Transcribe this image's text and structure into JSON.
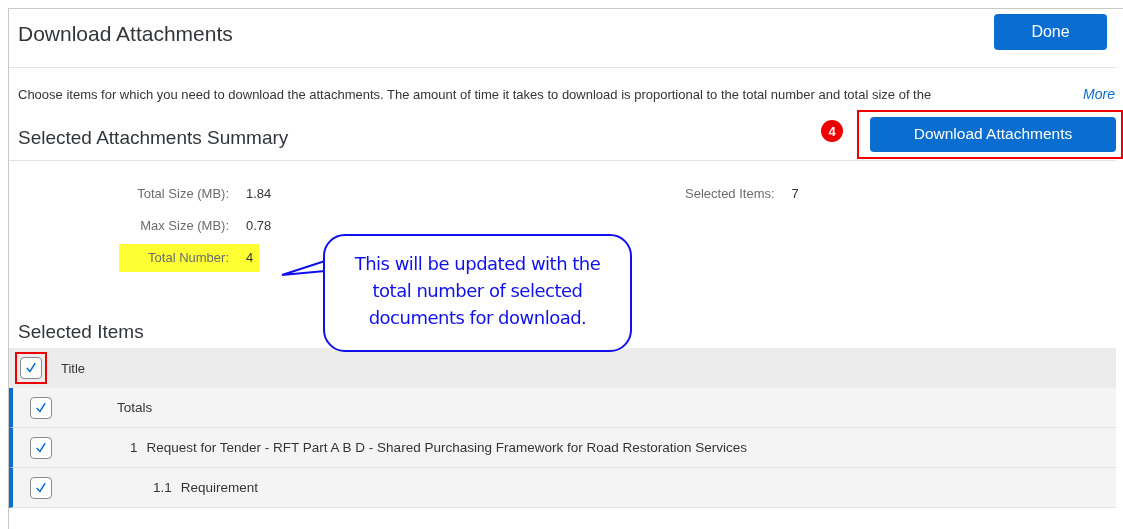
{
  "header": {
    "title": "Download Attachments",
    "done_button": "Done"
  },
  "description": {
    "text": "Choose items for which you need to download the attachments. The amount of time it takes to download is proportional to the total number and total size of the",
    "more_link": "More"
  },
  "summary": {
    "title": "Selected Attachments Summary",
    "download_button": {
      "label": "Download Attachments",
      "highlighted": true
    },
    "step_badge": "4",
    "stats_left": [
      {
        "label": "Total Size (MB):",
        "value": "1.84",
        "highlighted": false
      },
      {
        "label": "Max Size (MB):",
        "value": "0.78",
        "highlighted": false
      },
      {
        "label": "Total Number:",
        "value": "4",
        "highlighted": true
      }
    ],
    "stats_right": [
      {
        "label": "Selected Items:",
        "value": "7",
        "highlighted": false
      }
    ]
  },
  "callout": {
    "text": "This will be updated with the total number of selected documents for download."
  },
  "selected_items": {
    "title": "Selected Items",
    "select_all": {
      "checked": true,
      "highlighted": true
    },
    "columns": [
      "Title"
    ],
    "rows": [
      {
        "title": "Totals",
        "checked": true,
        "selected": true,
        "children": [
          {
            "number": "1",
            "title": "Request for Tender - RFT Part A B D - Shared Purchasing Framework for Road Restoration Services",
            "checked": true,
            "selected": true,
            "children": [
              {
                "number": "1.1",
                "title": "Requirement",
                "checked": true,
                "selected": true
              }
            ]
          }
        ]
      }
    ]
  }
}
